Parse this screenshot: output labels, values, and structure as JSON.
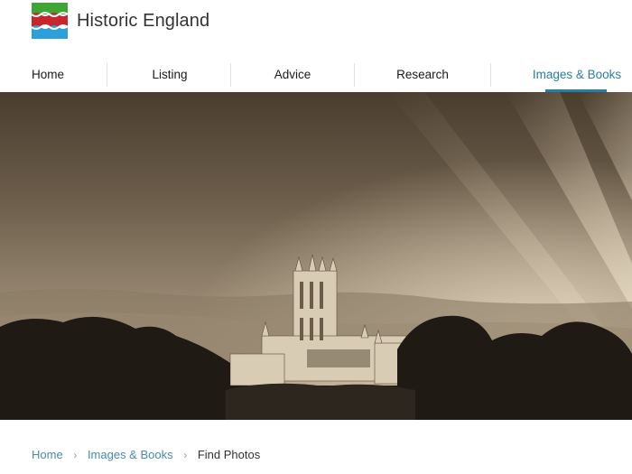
{
  "site": {
    "brand_name": "Historic England",
    "logo_icon": "historic-england-logo-icon",
    "logo_colors": {
      "green": "#3fa535",
      "red": "#c8262d",
      "blue": "#2e9fd9"
    }
  },
  "nav": {
    "items": [
      {
        "label": "Home"
      },
      {
        "label": "Listing"
      },
      {
        "label": "Advice"
      },
      {
        "label": "Research"
      },
      {
        "label": "Images & Books",
        "active": true
      }
    ],
    "accent_color": "#2a7ea0"
  },
  "hero": {
    "image": "sepia-photo-of-cathedral-tower-with-sun-rays-and-trees"
  },
  "breadcrumb": {
    "items": [
      {
        "label": "Home"
      },
      {
        "label": "Images & Books"
      },
      {
        "label": "Find Photos"
      }
    ],
    "separator_icon": "chevron-right-icon"
  }
}
